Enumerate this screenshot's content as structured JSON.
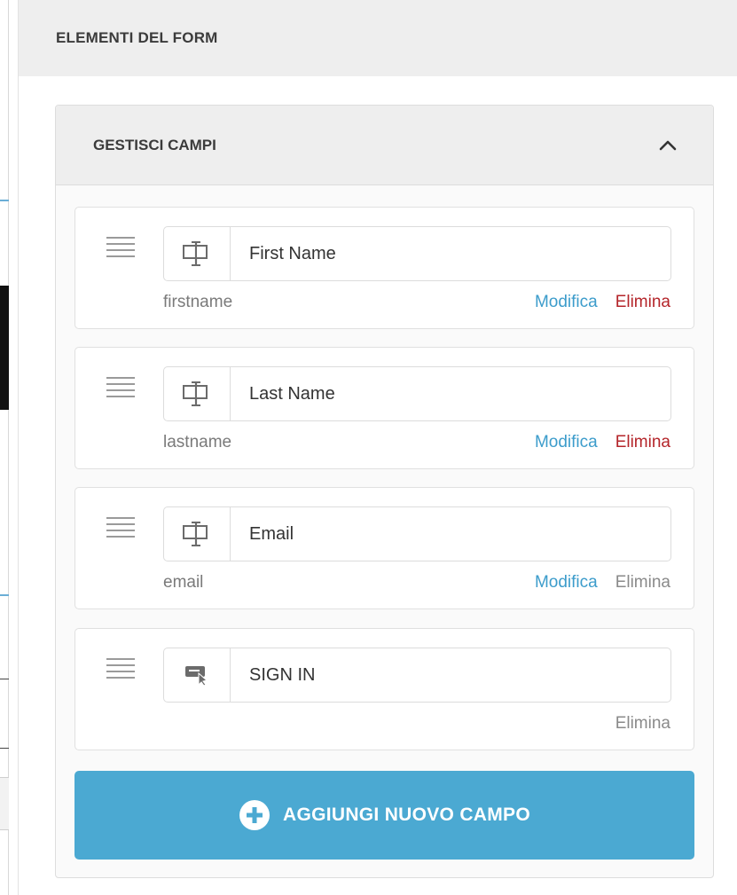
{
  "panel": {
    "title": "ELEMENTI DEL FORM"
  },
  "section": {
    "title": "GESTISCI CAMPI"
  },
  "fields": [
    {
      "label": "First Name",
      "key": "firstname",
      "icon": "text-field-icon",
      "edit": "Modifica",
      "delete": "Elimina"
    },
    {
      "label": "Last Name",
      "key": "lastname",
      "icon": "text-field-icon",
      "edit": "Modifica",
      "delete": "Elimina"
    },
    {
      "label": "Email",
      "key": "email",
      "icon": "text-field-icon",
      "edit": "Modifica",
      "delete": "Elimina"
    },
    {
      "label": "SIGN IN",
      "key": "",
      "icon": "button-click-icon",
      "edit": "",
      "delete": "Elimina"
    }
  ],
  "add_button": {
    "label": "AGGIUNGI NUOVO CAMPO",
    "icon": "plus-circle-icon"
  },
  "colors": {
    "accent": "#4ba9d2",
    "link": "#3c9ccb",
    "danger": "#b4252a",
    "muted": "#8a8a8a"
  }
}
